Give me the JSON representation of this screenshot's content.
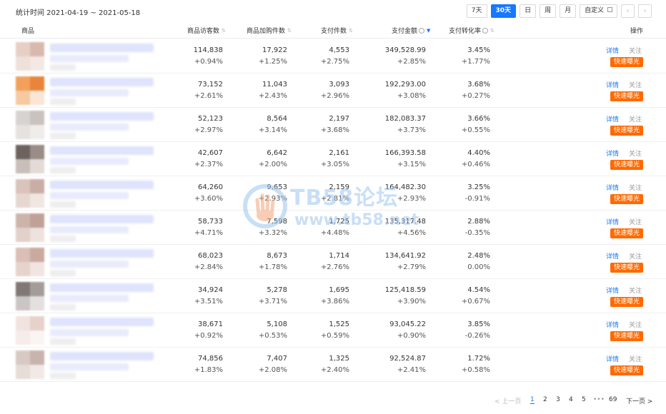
{
  "header": {
    "stat_time": "统计时间 2021-04-19 ~ 2021-05-18",
    "periods": [
      "7天",
      "30天",
      "日",
      "周",
      "月",
      "自定义"
    ],
    "active_period": "30天",
    "prev_arrow": "‹",
    "next_arrow": "›",
    "custom_icon": "calendar-icon"
  },
  "columns": {
    "product": "商品",
    "visitors": "商品访客数",
    "cart": "商品加购件数",
    "pay_items": "支付件数",
    "pay_amount": "支付金额",
    "conversion": "支付转化率",
    "actions": "操作"
  },
  "actions": {
    "detail": "详情",
    "follow": "关注",
    "boost": "快速曝光"
  },
  "rows": [
    {
      "visitors": "114,838",
      "visitors_change": "+0.94%",
      "cart": "17,922",
      "cart_change": "+1.25%",
      "pay_items": "4,553",
      "pay_items_change": "+2.75%",
      "pay_amount": "349,528.99",
      "pay_amount_change": "+2.85%",
      "conversion": "3.45%",
      "conversion_change": "+1.77%"
    },
    {
      "visitors": "73,152",
      "visitors_change": "+2.61%",
      "cart": "11,043",
      "cart_change": "+2.43%",
      "pay_items": "3,093",
      "pay_items_change": "+2.96%",
      "pay_amount": "192,293.00",
      "pay_amount_change": "+3.08%",
      "conversion": "3.68%",
      "conversion_change": "+0.27%"
    },
    {
      "visitors": "52,123",
      "visitors_change": "+2.97%",
      "cart": "8,564",
      "cart_change": "+3.14%",
      "pay_items": "2,197",
      "pay_items_change": "+3.68%",
      "pay_amount": "182,083.37",
      "pay_amount_change": "+3.73%",
      "conversion": "3.66%",
      "conversion_change": "+0.55%"
    },
    {
      "visitors": "42,607",
      "visitors_change": "+2.37%",
      "cart": "6,642",
      "cart_change": "+2.00%",
      "pay_items": "2,161",
      "pay_items_change": "+3.05%",
      "pay_amount": "166,393.58",
      "pay_amount_change": "+3.15%",
      "conversion": "4.40%",
      "conversion_change": "+0.46%"
    },
    {
      "visitors": "64,260",
      "visitors_change": "+3.60%",
      "cart": "9,653",
      "cart_change": "+2.93%",
      "pay_items": "2,159",
      "pay_items_change": "+2.81%",
      "pay_amount": "164,482.30",
      "pay_amount_change": "+2.93%",
      "conversion": "3.25%",
      "conversion_change": "-0.91%"
    },
    {
      "visitors": "58,733",
      "visitors_change": "+4.71%",
      "cart": "7,598",
      "cart_change": "+3.32%",
      "pay_items": "1,725",
      "pay_items_change": "+4.48%",
      "pay_amount": "135,317.48",
      "pay_amount_change": "+4.56%",
      "conversion": "2.88%",
      "conversion_change": "-0.35%"
    },
    {
      "visitors": "68,023",
      "visitors_change": "+2.84%",
      "cart": "8,673",
      "cart_change": "+1.78%",
      "pay_items": "1,714",
      "pay_items_change": "+2.76%",
      "pay_amount": "134,641.92",
      "pay_amount_change": "+2.79%",
      "conversion": "2.48%",
      "conversion_change": "0.00%"
    },
    {
      "visitors": "34,924",
      "visitors_change": "+3.51%",
      "cart": "5,278",
      "cart_change": "+3.71%",
      "pay_items": "1,695",
      "pay_items_change": "+3.86%",
      "pay_amount": "125,418.59",
      "pay_amount_change": "+3.90%",
      "conversion": "4.54%",
      "conversion_change": "+0.67%"
    },
    {
      "visitors": "38,671",
      "visitors_change": "+0.92%",
      "cart": "5,108",
      "cart_change": "+0.53%",
      "pay_items": "1,525",
      "pay_items_change": "+0.59%",
      "pay_amount": "93,045.22",
      "pay_amount_change": "+0.90%",
      "conversion": "3.85%",
      "conversion_change": "-0.26%"
    },
    {
      "visitors": "74,856",
      "visitors_change": "+1.83%",
      "cart": "7,407",
      "cart_change": "+2.08%",
      "pay_items": "1,325",
      "pay_items_change": "+2.40%",
      "pay_amount": "92,524.87",
      "pay_amount_change": "+2.41%",
      "conversion": "1.72%",
      "conversion_change": "+0.58%"
    }
  ],
  "thumb_colors": [
    [
      "#e8cfc6",
      "#d9b9ad",
      "#efe0da",
      "#f3e8e4"
    ],
    [
      "#f2a15a",
      "#e8853a",
      "#f6c9a0",
      "#fbe6d6"
    ],
    [
      "#d8d3d1",
      "#c9c2bf",
      "#e6e2e0",
      "#efecea"
    ],
    [
      "#6d625d",
      "#9a8c86",
      "#c9bfba",
      "#e2dbd8"
    ],
    [
      "#d9c3bb",
      "#c9aea5",
      "#e7d7d1",
      "#f0e6e2"
    ],
    [
      "#cdb4ab",
      "#bfa198",
      "#e2d0ca",
      "#ede2de"
    ],
    [
      "#d9bfb5",
      "#caa99e",
      "#e6d3cc",
      "#f0e5e1"
    ],
    [
      "#7f7875",
      "#a39c99",
      "#cbc6c4",
      "#e3e0df"
    ],
    [
      "#f1e3df",
      "#e6d1cb",
      "#f6ece9",
      "#faf4f2"
    ],
    [
      "#d8c9c3",
      "#c7b4ad",
      "#e6dcd8",
      "#f0e9e6"
    ]
  ],
  "pagination": {
    "prev": "< 上一页",
    "pages": [
      "1",
      "2",
      "3",
      "4",
      "5"
    ],
    "current": "1",
    "ellipsis": "•••",
    "last": "69",
    "next": "下一页 >"
  },
  "watermark": {
    "line1": "TB58论坛",
    "line2": "www.tb58.net"
  },
  "colors": {
    "accent": "#1677ff",
    "boost": "#ff6a00"
  }
}
